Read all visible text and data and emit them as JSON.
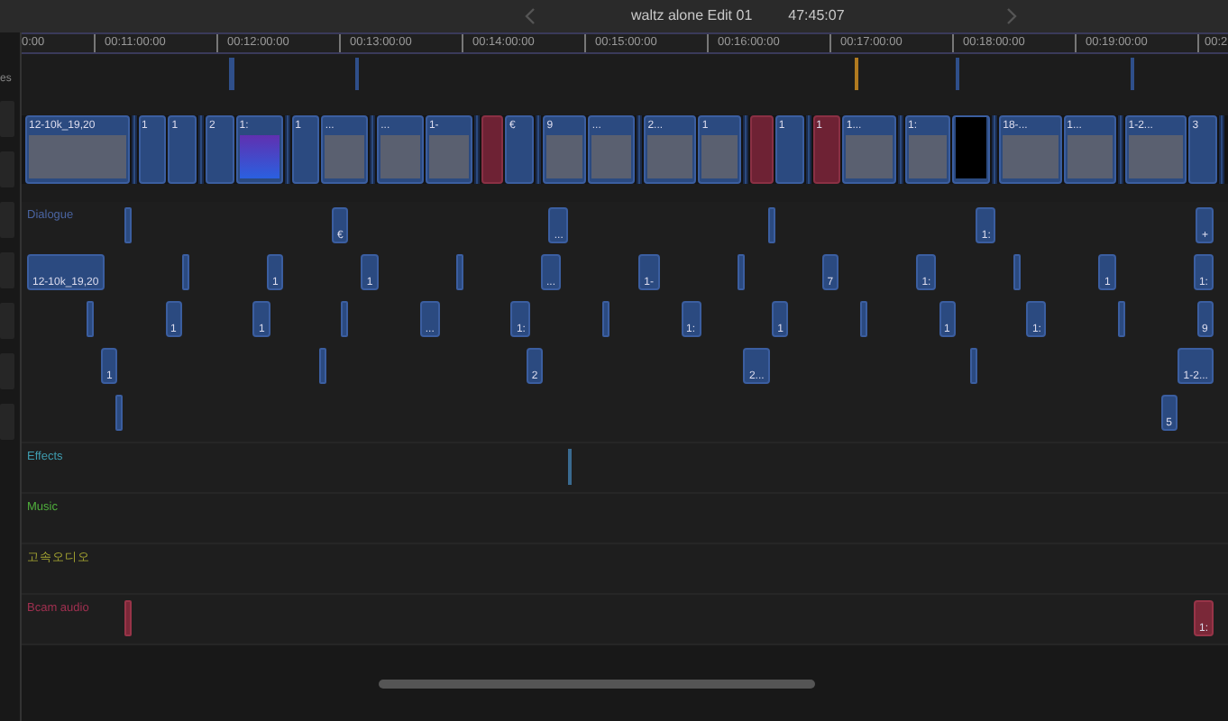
{
  "header": {
    "title": "waltz alone Edit 01",
    "duration": "47:45:07"
  },
  "sidebar": {
    "label": "es"
  },
  "ruler": [
    "0:00",
    "00:11:00:00",
    "00:12:00:00",
    "00:13:00:00",
    "00:14:00:00",
    "00:15:00:00",
    "00:16:00:00",
    "00:17:00:00",
    "00:18:00:00",
    "00:19:00:00",
    "00:2"
  ],
  "storyline": [
    {
      "label": "12-10k_19,20",
      "kind": "thumb"
    },
    {
      "label": "1",
      "kind": "clip"
    },
    {
      "label": "1",
      "kind": "clip"
    },
    {
      "label": "2",
      "kind": "clip"
    },
    {
      "label": "1:",
      "kind": "purple"
    },
    {
      "label": "1",
      "kind": "clip"
    },
    {
      "label": "...",
      "kind": "thumb"
    },
    {
      "label": "...",
      "kind": "thumb"
    },
    {
      "label": "1-",
      "kind": "thumb"
    },
    {
      "kind": "red"
    },
    {
      "label": "€",
      "kind": "clip"
    },
    {
      "label": "9",
      "kind": "thumb"
    },
    {
      "label": "...",
      "kind": "thumb"
    },
    {
      "label": "2...",
      "kind": "thumb"
    },
    {
      "label": "1",
      "kind": "thumb"
    },
    {
      "kind": "red"
    },
    {
      "label": "1",
      "kind": "clip"
    },
    {
      "label": "1",
      "kind": "red"
    },
    {
      "label": "1...",
      "kind": "thumb"
    },
    {
      "label": "1:",
      "kind": "thumb"
    },
    {
      "kind": "black"
    },
    {
      "label": "18-...",
      "kind": "thumb"
    },
    {
      "label": "1...",
      "kind": "thumb"
    },
    {
      "label": "1-2...",
      "kind": "thumb"
    },
    {
      "label": "3",
      "kind": "clip"
    }
  ],
  "roles": [
    {
      "name": "Dialogue",
      "color": "#4a64a0",
      "rows": [
        [
          "€",
          "...",
          "1:",
          "+"
        ],
        [
          "12-10k_19,20",
          "1",
          "1",
          "...",
          "1-",
          "7",
          "1:",
          "1",
          "1:"
        ],
        [
          "1",
          "1",
          "...",
          "1:",
          "1:",
          "1",
          "1",
          "1:",
          "9"
        ],
        [
          "1",
          "2",
          "2...",
          "1-2..."
        ],
        [
          "5"
        ]
      ]
    },
    {
      "name": "Effects",
      "color": "#3f9db0",
      "rows": [
        []
      ]
    },
    {
      "name": "Music",
      "color": "#4fae3c",
      "rows": [
        []
      ]
    },
    {
      "name": "고속오디오",
      "color": "#a8a832",
      "rows": [
        []
      ]
    },
    {
      "name": "Bcam audio",
      "color": "#a03050",
      "rows": [
        [
          "1:"
        ]
      ]
    }
  ]
}
